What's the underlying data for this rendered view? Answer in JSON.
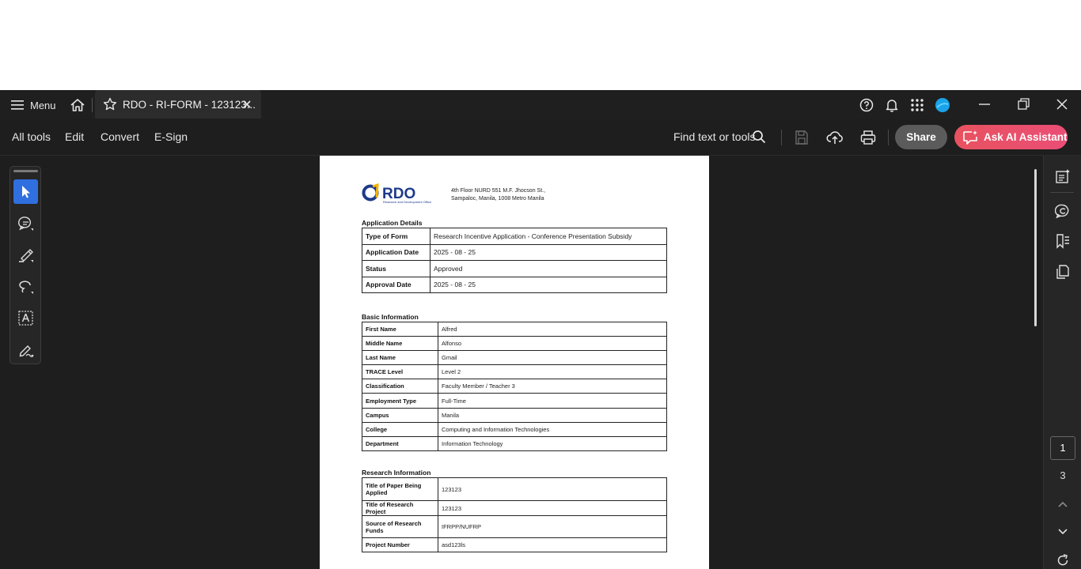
{
  "titlebar": {
    "menu_label": "Menu",
    "tab_title": "RDO - RI-FORM - 123123...",
    "profile_color": "#1aa3e8"
  },
  "toolbar": {
    "menus": [
      "All tools",
      "Edit",
      "Convert",
      "E-Sign"
    ],
    "find_label": "Find text or tools",
    "share_label": "Share",
    "ai_label": "Ask AI Assistant"
  },
  "document": {
    "logo_text": "RDO",
    "logo_subtitle": "Research and Development Office",
    "address_line1": "4th Floor NURD 551 M.F. Jhocson St.,",
    "address_line2": "Sampaloc, Manila, 1008 Metro Manila",
    "application_details": {
      "title": "Application Details",
      "rows": [
        {
          "key": "Type of Form",
          "value": "Research Incentive Application - Conference Presentation Subsidy"
        },
        {
          "key": "Application Date",
          "value": "2025 - 08 - 25"
        },
        {
          "key": "Status",
          "value": "Approved"
        },
        {
          "key": "Approval Date",
          "value": "2025 - 08 - 25"
        }
      ]
    },
    "basic_information": {
      "title": "Basic Information",
      "rows": [
        {
          "key": "First Name",
          "value": "Alfred"
        },
        {
          "key": "Middle Name",
          "value": "Alfonso"
        },
        {
          "key": "Last Name",
          "value": "Gmail"
        },
        {
          "key": "TRACE Level",
          "value": "Level 2"
        },
        {
          "key": "Classification",
          "value": "Faculty Member / Teacher 3"
        },
        {
          "key": "Employment Type",
          "value": "Full-Time"
        },
        {
          "key": "Campus",
          "value": "Manila"
        },
        {
          "key": "College",
          "value": "Computing and Information Technologies"
        },
        {
          "key": "Department",
          "value": "Information Technology"
        }
      ]
    },
    "research_information": {
      "title": "Research Information",
      "rows": [
        {
          "key": "Title of Paper Being Applied",
          "value": "123123"
        },
        {
          "key": "Title of Research Project",
          "value": "123123"
        },
        {
          "key": "Source of Research Funds",
          "value": "IFRPP/NUFRP"
        },
        {
          "key": "Project Number",
          "value": "asd123ls"
        }
      ]
    }
  },
  "pagination": {
    "current_page": "1",
    "total_pages": "3"
  },
  "colors": {
    "accent_blue": "#2f6fdf",
    "ai_gradient_start": "#e8525f",
    "ai_gradient_end": "#ea4e76",
    "logo_blue": "#1e3a8a"
  }
}
